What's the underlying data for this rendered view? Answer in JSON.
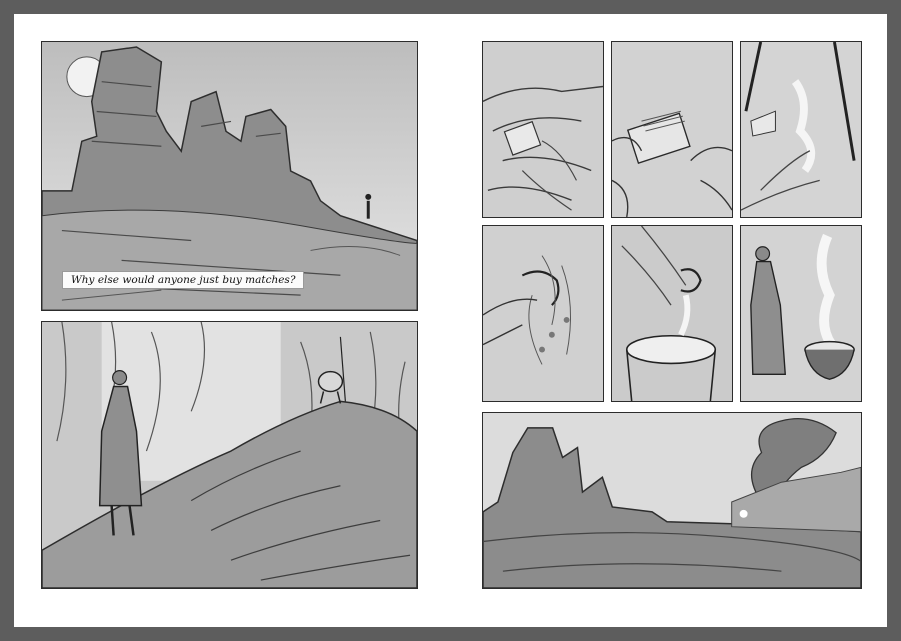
{
  "spread": {
    "caption": "Why else would anyone just buy matches?"
  },
  "colors": {
    "background": "#5d5d5d",
    "page": "#ffffff",
    "panel_border": "#2c2c2c"
  }
}
